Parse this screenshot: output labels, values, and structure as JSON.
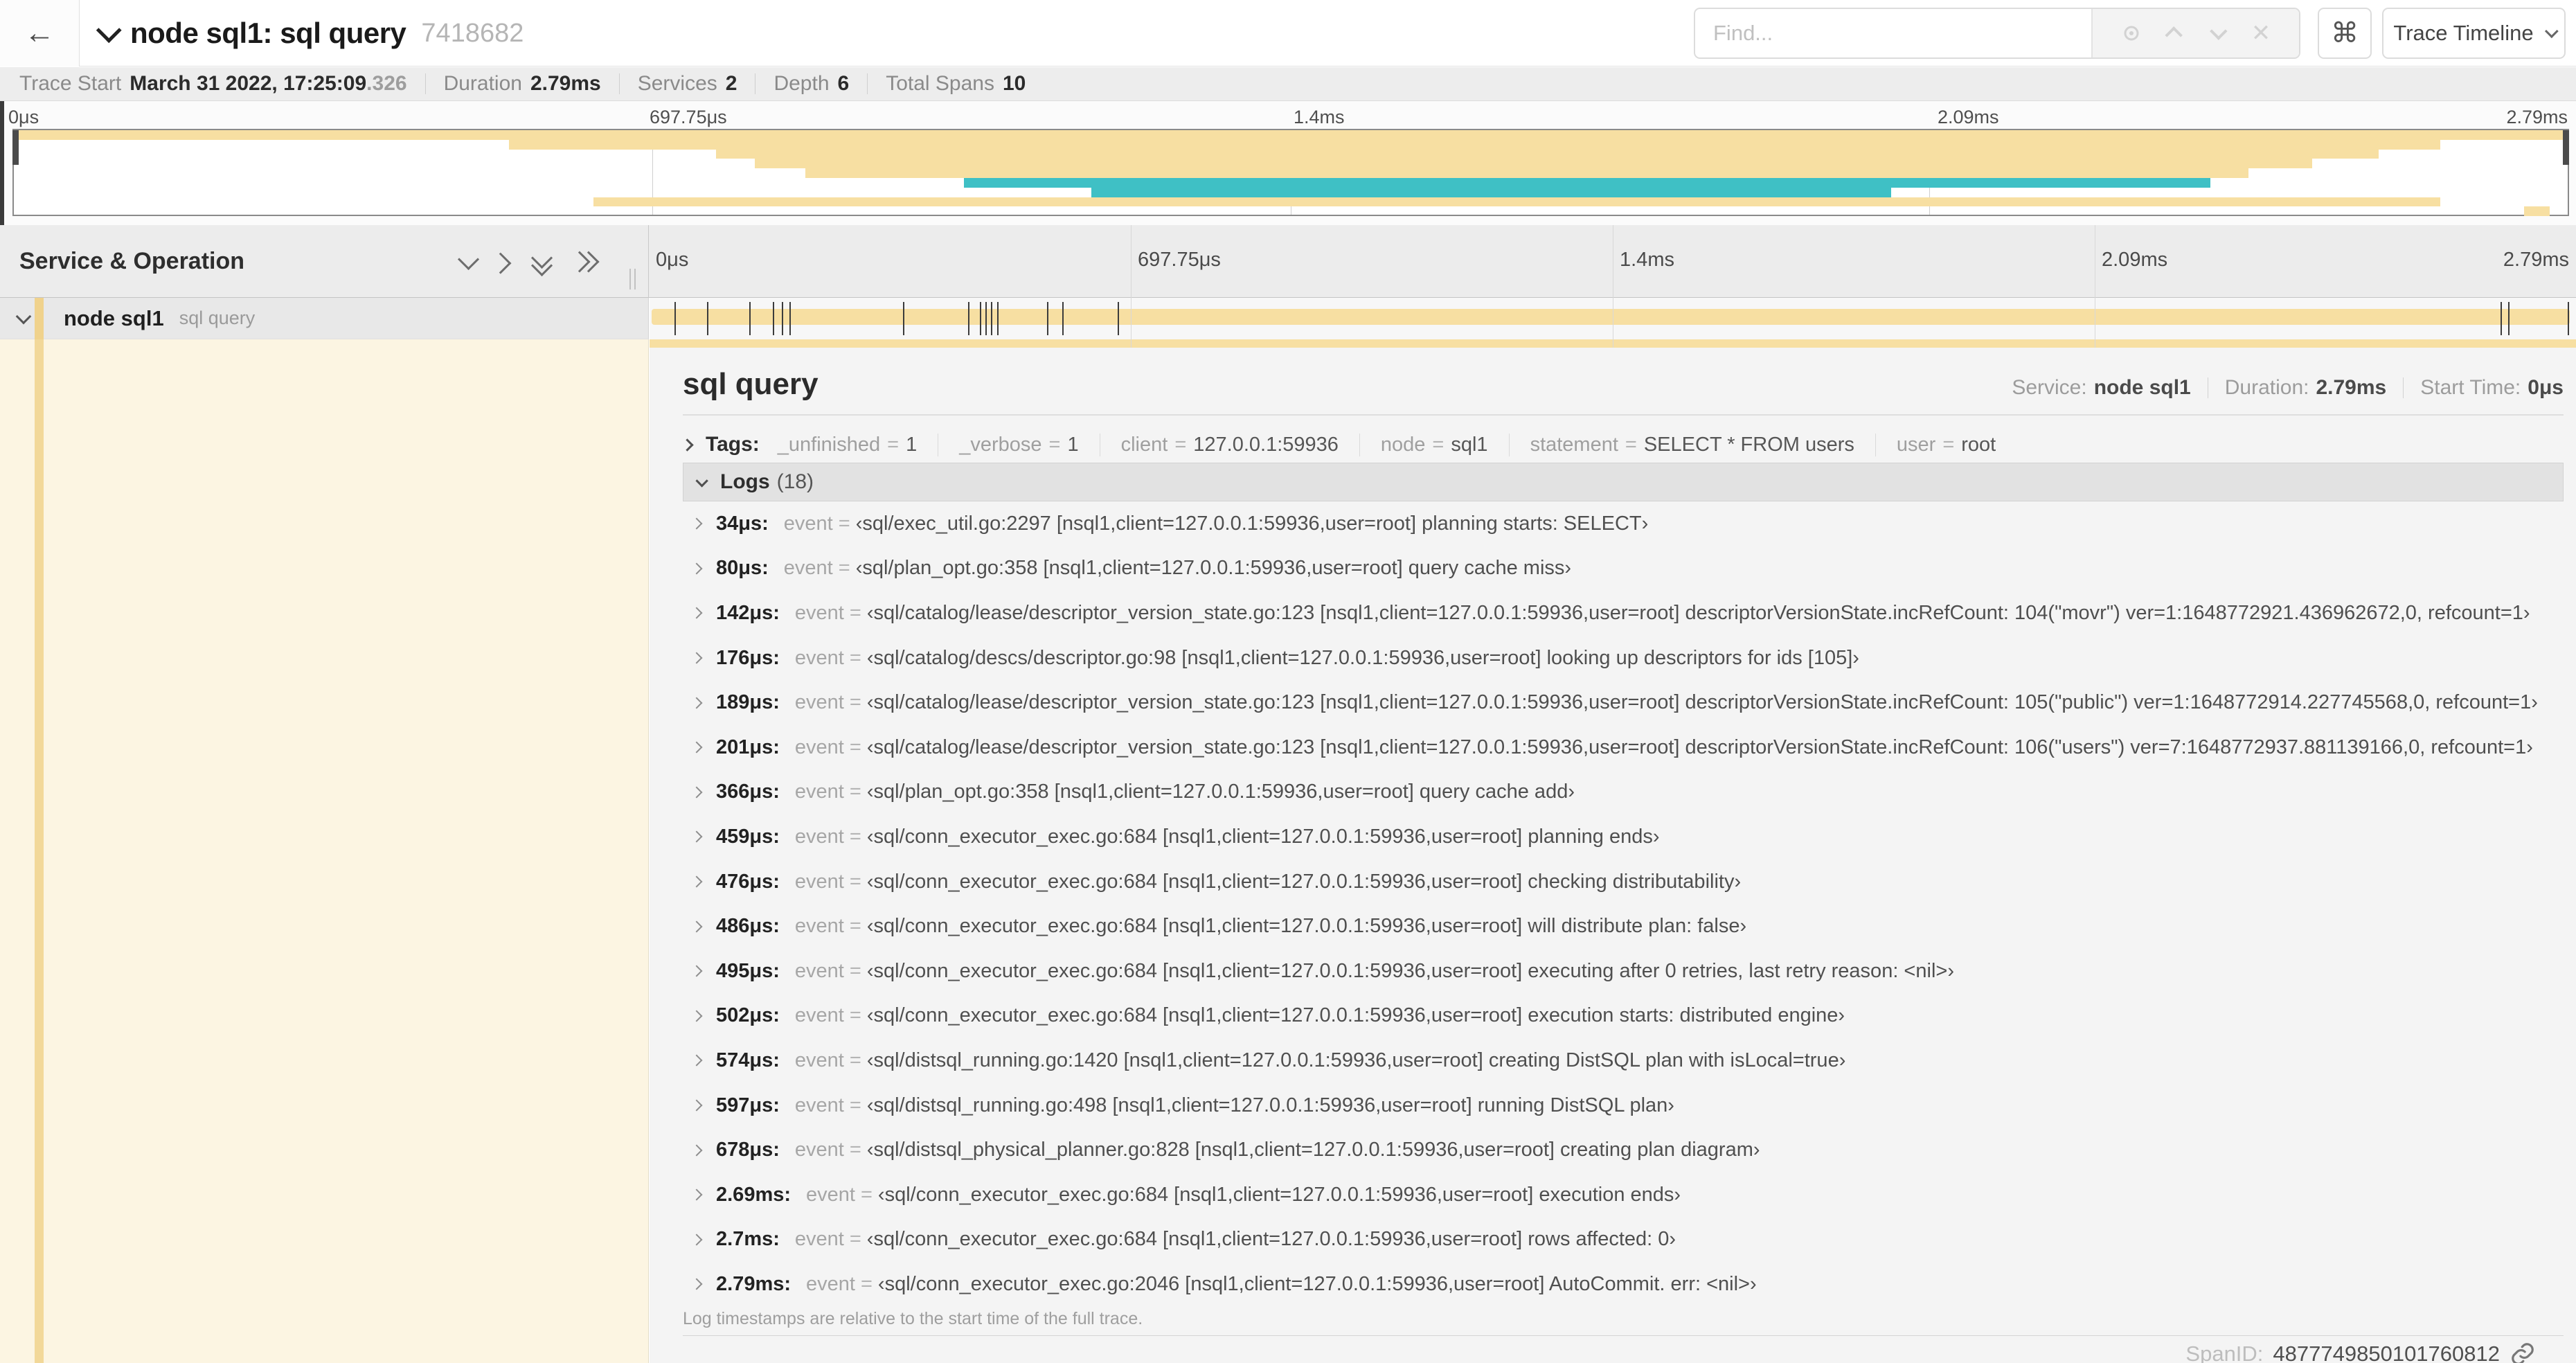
{
  "colors": {
    "span_tan": "#f7dfa2",
    "span_teal": "#3fc0c5",
    "accent_tan": "#f0d28c"
  },
  "header": {
    "back_icon": "arrow-left",
    "title": "node sql1: sql query",
    "trace_id": "7418682",
    "find_placeholder": "Find...",
    "shortcut_icon": "⌘",
    "view_selector_label": "Trace Timeline"
  },
  "summary": {
    "trace_start_label": "Trace Start",
    "trace_start_value": "March 31 2022, 17:25:09",
    "trace_start_fraction": ".326",
    "duration_label": "Duration",
    "duration_value": "2.79ms",
    "services_label": "Services",
    "services_value": "2",
    "depth_label": "Depth",
    "depth_value": "6",
    "total_spans_label": "Total Spans",
    "total_spans_value": "10"
  },
  "minimap": {
    "ticks": [
      "0μs",
      "697.75μs",
      "1.4ms",
      "2.09ms",
      "2.79ms"
    ],
    "spans": [
      {
        "row": 0,
        "color": "tan",
        "start": 0,
        "end": 100
      },
      {
        "row": 1,
        "color": "tan",
        "start": 19.4,
        "end": 95
      },
      {
        "row": 2,
        "color": "tan",
        "start": 27.5,
        "end": 92.6
      },
      {
        "row": 3,
        "color": "tan",
        "start": 29,
        "end": 90
      },
      {
        "row": 4,
        "color": "tan",
        "start": 31,
        "end": 87.5
      },
      {
        "row": 5,
        "color": "teal",
        "start": 37.2,
        "end": 86
      },
      {
        "row": 6,
        "color": "teal",
        "start": 42.2,
        "end": 73.5
      },
      {
        "row": 7,
        "color": "tan",
        "start": 22.7,
        "end": 95
      },
      {
        "row": 8,
        "color": "tan",
        "start": 98.3,
        "end": 99.3
      }
    ]
  },
  "timeline": {
    "left_header": "Service & Operation",
    "ticks": [
      "0μs",
      "697.75μs",
      "1.4ms",
      "2.09ms",
      "2.79ms"
    ],
    "row": {
      "service": "node sql1",
      "operation": "sql query"
    },
    "log_marker_percents": [
      1.2,
      2.9,
      5.1,
      6.3,
      6.8,
      7.2,
      13.1,
      16.5,
      17.1,
      17.4,
      17.7,
      18.0,
      20.6,
      21.4,
      24.3,
      96.4,
      96.8,
      99.9
    ]
  },
  "detail": {
    "title": "sql query",
    "service_label": "Service:",
    "service_value": "node sql1",
    "duration_label": "Duration:",
    "duration_value": "2.79ms",
    "start_label": "Start Time:",
    "start_value": "0μs",
    "tags_label": "Tags:",
    "tags": [
      {
        "key": "_unfinished",
        "value": "1"
      },
      {
        "key": "_verbose",
        "value": "1"
      },
      {
        "key": "client",
        "value": "127.0.0.1:59936"
      },
      {
        "key": "node",
        "value": "sql1"
      },
      {
        "key": "statement",
        "value": "SELECT * FROM users"
      },
      {
        "key": "user",
        "value": "root"
      }
    ],
    "logs_label": "Logs",
    "logs_count": "(18)",
    "event_key": "event",
    "logs": [
      {
        "t": "34μs:",
        "v": "‹sql/exec_util.go:2297 [nsql1,client=127.0.0.1:59936,user=root] planning starts: SELECT›"
      },
      {
        "t": "80μs:",
        "v": "‹sql/plan_opt.go:358 [nsql1,client=127.0.0.1:59936,user=root] query cache miss›"
      },
      {
        "t": "142μs:",
        "v": "‹sql/catalog/lease/descriptor_version_state.go:123 [nsql1,client=127.0.0.1:59936,user=root] descriptorVersionState.incRefCount: 104(\"movr\") ver=1:1648772921.436962672,0, refcount=1›"
      },
      {
        "t": "176μs:",
        "v": "‹sql/catalog/descs/descriptor.go:98 [nsql1,client=127.0.0.1:59936,user=root] looking up descriptors for ids [105]›"
      },
      {
        "t": "189μs:",
        "v": "‹sql/catalog/lease/descriptor_version_state.go:123 [nsql1,client=127.0.0.1:59936,user=root] descriptorVersionState.incRefCount: 105(\"public\") ver=1:1648772914.227745568,0, refcount=1›"
      },
      {
        "t": "201μs:",
        "v": "‹sql/catalog/lease/descriptor_version_state.go:123 [nsql1,client=127.0.0.1:59936,user=root] descriptorVersionState.incRefCount: 106(\"users\") ver=7:1648772937.881139166,0, refcount=1›"
      },
      {
        "t": "366μs:",
        "v": "‹sql/plan_opt.go:358 [nsql1,client=127.0.0.1:59936,user=root] query cache add›"
      },
      {
        "t": "459μs:",
        "v": "‹sql/conn_executor_exec.go:684 [nsql1,client=127.0.0.1:59936,user=root] planning ends›"
      },
      {
        "t": "476μs:",
        "v": "‹sql/conn_executor_exec.go:684 [nsql1,client=127.0.0.1:59936,user=root] checking distributability›"
      },
      {
        "t": "486μs:",
        "v": "‹sql/conn_executor_exec.go:684 [nsql1,client=127.0.0.1:59936,user=root] will distribute plan: false›"
      },
      {
        "t": "495μs:",
        "v": "‹sql/conn_executor_exec.go:684 [nsql1,client=127.0.0.1:59936,user=root] executing after 0 retries, last retry reason: <nil>›"
      },
      {
        "t": "502μs:",
        "v": "‹sql/conn_executor_exec.go:684 [nsql1,client=127.0.0.1:59936,user=root] execution starts: distributed engine›"
      },
      {
        "t": "574μs:",
        "v": "‹sql/distsql_running.go:1420 [nsql1,client=127.0.0.1:59936,user=root] creating DistSQL plan with isLocal=true›"
      },
      {
        "t": "597μs:",
        "v": "‹sql/distsql_running.go:498 [nsql1,client=127.0.0.1:59936,user=root] running DistSQL plan›"
      },
      {
        "t": "678μs:",
        "v": "‹sql/distsql_physical_planner.go:828 [nsql1,client=127.0.0.1:59936,user=root] creating plan diagram›"
      },
      {
        "t": "2.69ms:",
        "v": "‹sql/conn_executor_exec.go:684 [nsql1,client=127.0.0.1:59936,user=root] execution ends›"
      },
      {
        "t": "2.7ms:",
        "v": "‹sql/conn_executor_exec.go:684 [nsql1,client=127.0.0.1:59936,user=root] rows affected: 0›"
      },
      {
        "t": "2.79ms:",
        "v": "‹sql/conn_executor_exec.go:2046 [nsql1,client=127.0.0.1:59936,user=root] AutoCommit. err: <nil>›"
      }
    ],
    "footer_note": "Log timestamps are relative to the start time of the full trace.",
    "spanid_label": "SpanID:",
    "spanid_value": "4877749850101760812"
  }
}
